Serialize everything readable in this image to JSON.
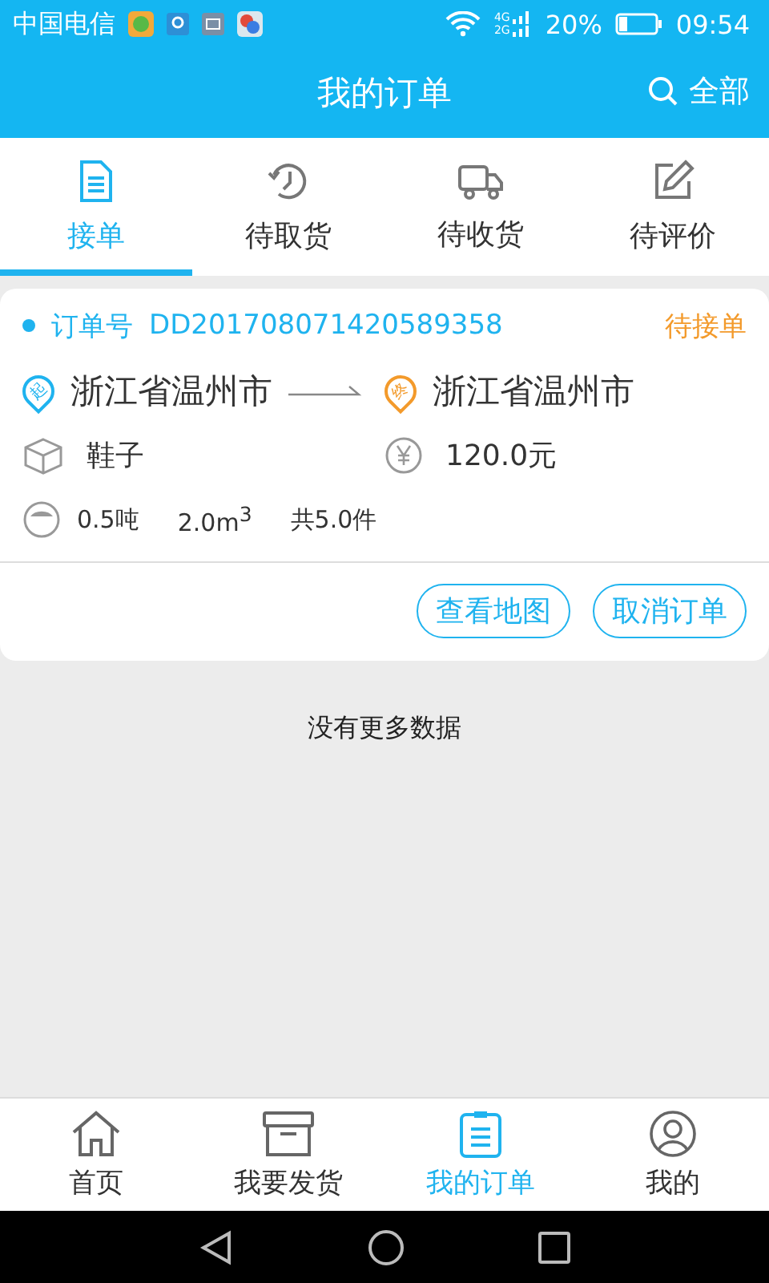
{
  "status_bar": {
    "carrier": "中国电信",
    "network_top": "4G",
    "network_bottom": "2G",
    "battery_text": "20%",
    "time": "09:54"
  },
  "header": {
    "title": "我的订单",
    "filter": "全部"
  },
  "tabs": [
    {
      "label": "接单",
      "selected": true
    },
    {
      "label": "待取货",
      "selected": false
    },
    {
      "label": "待收货",
      "selected": false
    },
    {
      "label": "待评价",
      "selected": false
    }
  ],
  "orders": [
    {
      "number_label": "订单号",
      "number": "DD201708071420589358",
      "status": "待接单",
      "origin_mark": "起",
      "origin": "浙江省温州市",
      "dest_mark": "终",
      "destination": "浙江省温州市",
      "goods": "鞋子",
      "price": "120.0元",
      "weight": "0.5吨",
      "volume": "2.0m$^{3}$",
      "count": "共5.0件",
      "actions": [
        "查看地图",
        "取消订单"
      ]
    }
  ],
  "end_note": "没有更多数据",
  "bottom_nav": [
    {
      "label": "首页",
      "selected": false
    },
    {
      "label": "我要发货",
      "selected": false
    },
    {
      "label": "我的订单",
      "selected": true
    },
    {
      "label": "我的",
      "selected": false
    }
  ]
}
